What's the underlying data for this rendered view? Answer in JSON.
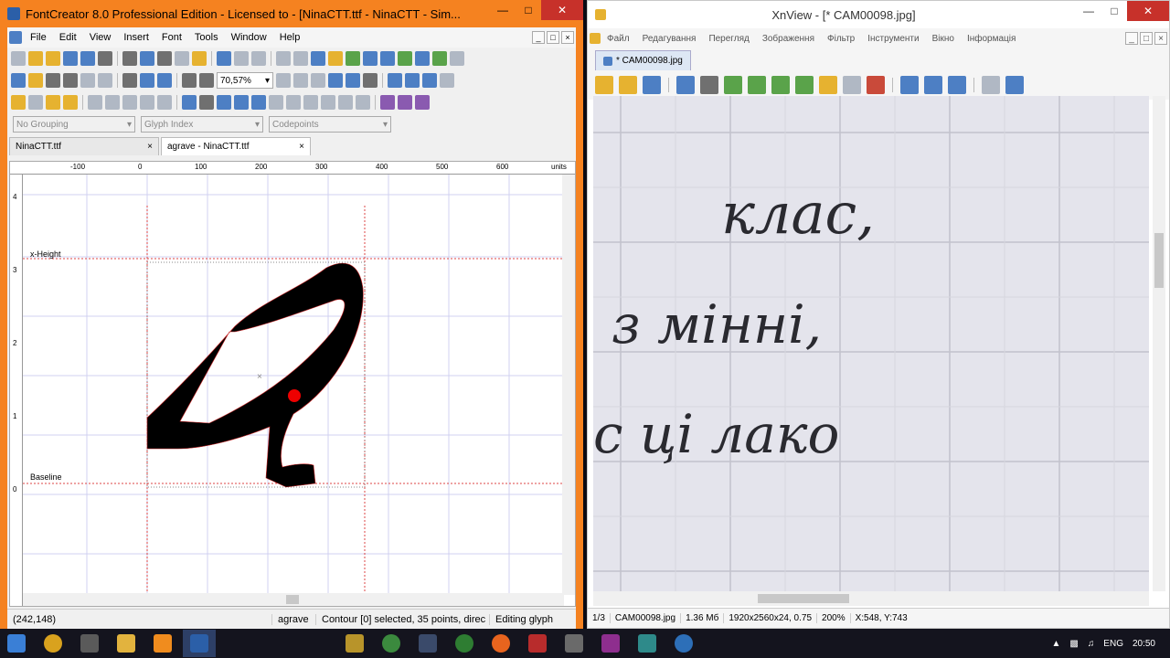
{
  "fc": {
    "title": "FontCreator 8.0 Professional Edition - Licensed to  - [NinaCTT.ttf - NinaCTT - Sim...",
    "menu": [
      "File",
      "Edit",
      "View",
      "Insert",
      "Font",
      "Tools",
      "Window",
      "Help"
    ],
    "zoom": "70,57%",
    "grouping": "No Grouping",
    "sort": "Glyph Index",
    "codepoints": "Codepoints",
    "tabs": [
      "NinaCTT.ttf",
      "agrave - NinaCTT.ttf"
    ],
    "guides": {
      "xheight": "x-Height",
      "baseline": "Baseline"
    },
    "ruler_top": [
      "-100",
      "0",
      "100",
      "200",
      "300",
      "400",
      "500",
      "600",
      "units"
    ],
    "ruler_left": [
      "4",
      "3",
      "2",
      "1",
      "0"
    ],
    "status": {
      "coords": "(242,148)",
      "glyph": "agrave",
      "contour": "Contour [0] selected, 35 points, direc",
      "mode": "Editing glyph"
    }
  },
  "xv": {
    "title": "XnView - [* CAM00098.jpg]",
    "menu": [
      "Файл",
      "Редагування",
      "Перегляд",
      "Зображення",
      "Фільтр",
      "Інструменти",
      "Вікно",
      "Інформація"
    ],
    "tab": "* CAM00098.jpg",
    "photo_lines": [
      "клас,",
      "з мінні,",
      "с ці лако"
    ],
    "status": {
      "index": "1/3",
      "file": "CAM00098.jpg",
      "size": "1.36 Мб",
      "dims": "1920x2560x24, 0.75",
      "zoom": "200%",
      "pos": "X:548, Y:743"
    }
  },
  "taskbar": {
    "lang": "ENG",
    "time": "20:50"
  },
  "colors": {
    "fc_frame": "#f58220",
    "close": "#c7312a",
    "taskbar": "#14141e"
  }
}
